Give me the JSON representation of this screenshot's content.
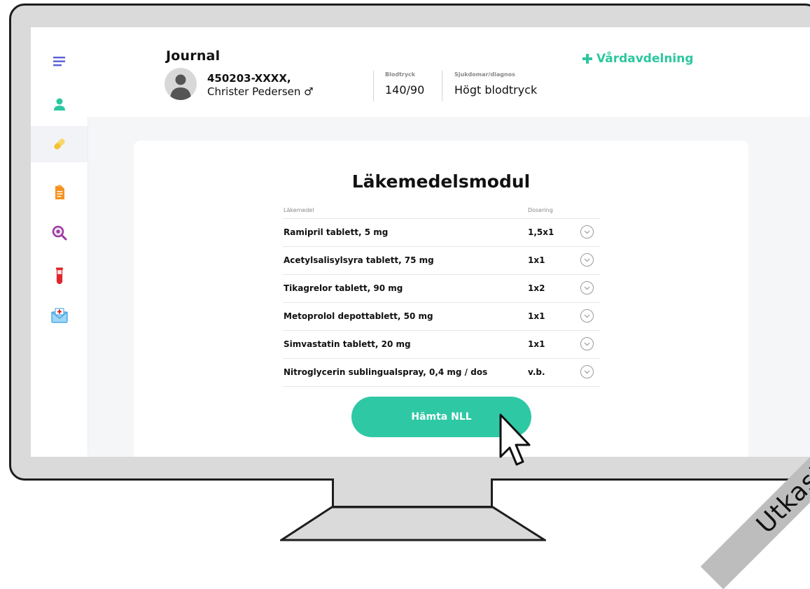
{
  "header": {
    "title": "Journal",
    "patient_id": "450203-XXXX,",
    "patient_name": "Christer Pedersen",
    "gender_symbol": "♂",
    "blood_pressure_label": "Blodtryck",
    "blood_pressure_value": "140/90",
    "diagnosis_label": "Sjukdomar/diagnos",
    "diagnosis_value": "Högt blodtryck",
    "ward_link_label": "Vårdavdelning"
  },
  "sidebar": {
    "items": [
      {
        "icon": "menu-icon",
        "color": "#5a5fd6"
      },
      {
        "icon": "user-icon",
        "color": "#2cc7a0"
      },
      {
        "icon": "pill-icon",
        "color": "#f2c230",
        "active": true
      },
      {
        "icon": "document-icon",
        "color": "#f5921e"
      },
      {
        "icon": "search-icon",
        "color": "#9b3aa0"
      },
      {
        "icon": "test-tube-icon",
        "color": "#e0262b"
      },
      {
        "icon": "mail-icon",
        "color": "#3aa0e0"
      }
    ]
  },
  "module": {
    "title": "Läkemedelsmodul",
    "column_medication": "Läkemedel",
    "column_dosage": "Dosering",
    "medications": [
      {
        "name": "Ramipril tablett, 5 mg",
        "dosage": "1,5x1"
      },
      {
        "name": "Acetylsalisylsyra tablett, 75 mg",
        "dosage": "1x1"
      },
      {
        "name": "Tikagrelor tablett, 90 mg",
        "dosage": "1x2"
      },
      {
        "name": "Metoprolol depottablett, 50 mg",
        "dosage": "1x1"
      },
      {
        "name": "Simvastatin tablett, 20 mg",
        "dosage": "1x1"
      },
      {
        "name": "Nitroglycerin sublingualspray, 0,4 mg / dos",
        "dosage": "v.b."
      }
    ],
    "fetch_button_label": "Hämta NLL"
  },
  "watermark": "Utkast",
  "colors": {
    "accent": "#2cc7a0",
    "button": "#2fc8a5"
  }
}
